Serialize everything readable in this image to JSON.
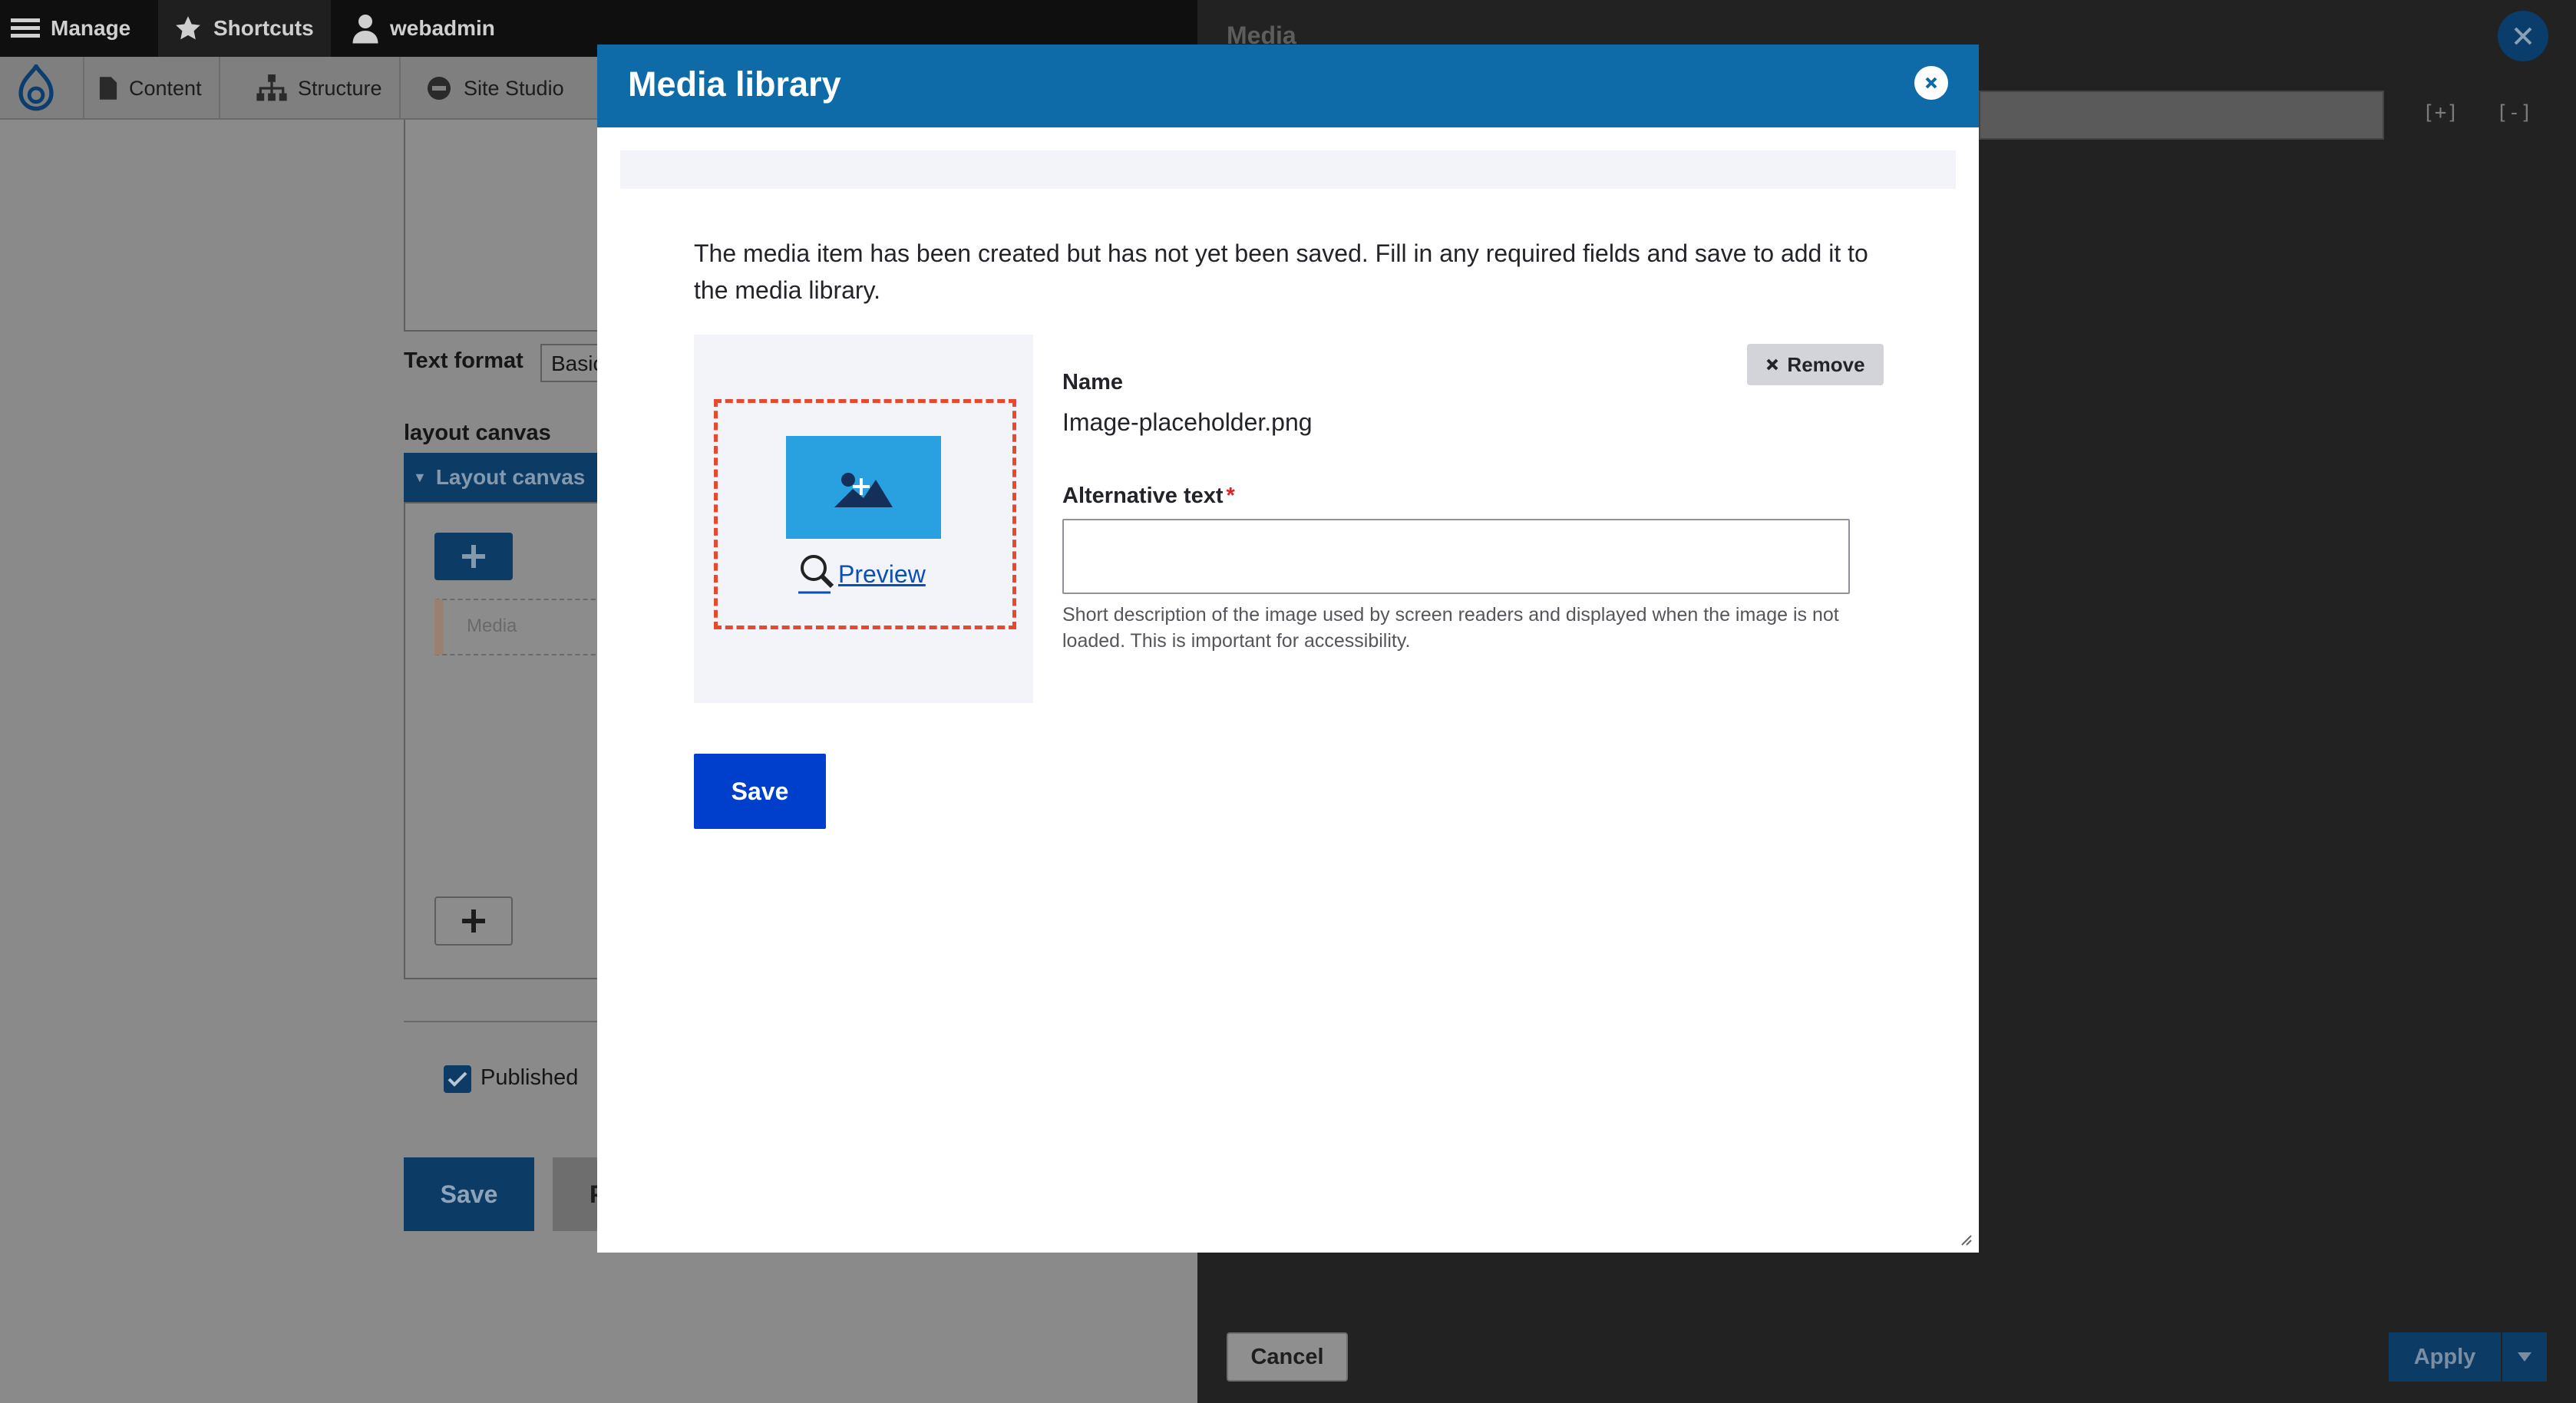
{
  "toolbar": {
    "manage": "Manage",
    "shortcuts": "Shortcuts",
    "user": "webadmin"
  },
  "tray": {
    "items": [
      {
        "label": "Content",
        "icon": "file-icon"
      },
      {
        "label": "Structure",
        "icon": "structure-icon"
      },
      {
        "label": "Site Studio",
        "icon": "site-studio-icon"
      }
    ]
  },
  "background_form": {
    "text_format_label": "Text format",
    "text_format_value": "Basic",
    "layout_canvas_heading": "layout canvas",
    "layout_canvas_tab": "Layout canvas",
    "media_placeholder": "Media",
    "published_label": "Published",
    "published_checked": true,
    "save_label": "Save",
    "preview_label": "P"
  },
  "sidebar": {
    "title": "Media",
    "expand_icon_text": "[+]",
    "collapse_icon_text": "[-]",
    "cancel_label": "Cancel",
    "apply_label": "Apply"
  },
  "modal": {
    "title": "Media library",
    "message": "The media item has been created but has not yet been saved. Fill in any required fields and save to add it to the media library.",
    "preview_label": "Preview",
    "remove_label": "Remove",
    "name_label": "Name",
    "name_value": "Image-placeholder.png",
    "alt_label": "Alternative text",
    "alt_required_marker": "*",
    "alt_value": "",
    "alt_description": "Short description of the image used by screen readers and displayed when the image is not loaded. This is important for accessibility.",
    "save_label": "Save"
  },
  "colors": {
    "modal_header": "#0f6aa8",
    "primary_button": "#003ecc",
    "focus_dash": "#e64a2e",
    "thumbnail": "#29a1e0"
  }
}
